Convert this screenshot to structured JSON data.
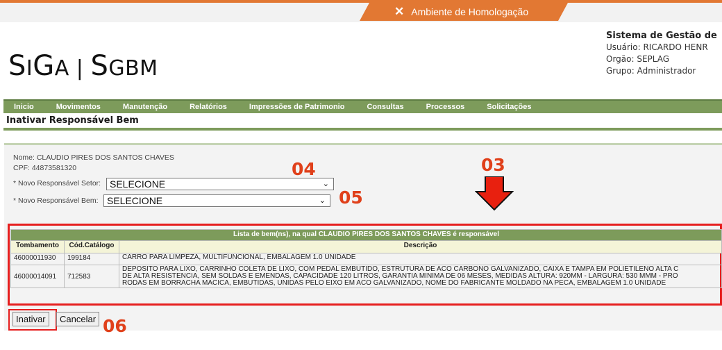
{
  "environment": {
    "label": "Ambiente de Homologação",
    "icon": "tools-icon",
    "color": "#e27833"
  },
  "logo": {
    "text_big_1": "S",
    "text_small_1": "I",
    "text_big_2": "G",
    "text_small_2": "A | ",
    "text_big_3": "S",
    "text_small_3": "GBM"
  },
  "system": {
    "title": "Sistema de Gestão de",
    "user": "Usuário: RICARDO HENR",
    "orgao": "Orgão: SEPLAG",
    "grupo": "Grupo: Administrador"
  },
  "menu": [
    "Inicio",
    "Movimentos",
    "Manutenção",
    "Relatórios",
    "Impressões de Patrimonio",
    "Consultas",
    "Processos",
    "Solicitações"
  ],
  "page_title": "Inativar Responsável Bem",
  "person": {
    "nome": "Nome: CLAUDIO PIRES DOS SANTOS CHAVES",
    "cpf": "CPF:  44873581320"
  },
  "fields": {
    "setor_label": "* Novo Responsável Setor:",
    "setor_value": "SELECIONE",
    "bem_label": "* Novo Responsável Bem:",
    "bem_value": "SELECIONE"
  },
  "annotations": {
    "a03": "03",
    "a04": "04",
    "a05": "05",
    "a06": "06"
  },
  "table": {
    "caption": "Lista de bem(ns), na qual CLAUDIO PIRES DOS SANTOS CHAVES é responsável",
    "headers": [
      "Tombamento",
      "Cód.Catálogo",
      "Descrição"
    ],
    "rows": [
      {
        "tombamento": "46000011930",
        "catalogo": "199184",
        "descricao": [
          "CARRO PARA LIMPEZA, MULTIFUNCIONAL, EMBALAGEM 1.0 UNIDADE"
        ]
      },
      {
        "tombamento": "46000014091",
        "catalogo": "712583",
        "descricao": [
          "DEPOSITO PARA LIXO, CARRINHO COLETA DE LIXO, COM PEDAL EMBUTIDO, ESTRUTURA DE ACO CARBONO GALVANIZADO, CAIXA E TAMPA EM POLIETILENO ALTA C",
          "DE ALTA RESISTENCIA, SEM SOLDAS E EMENDAS, CAPACIDADE 120 LITROS, GARANTIA MINIMA DE 06 MESES, MEDIDAS ALTURA: 920MM - LARGURA: 530 MMM - PRO",
          "RODAS EM BORRACHA MACICA, EMBUTIDAS, UNIDAS PELO EIXO EM ACO GALVANIZADO, NOME DO FABRICANTE MOLDADO NA PECA, EMBALAGEM 1.0 UNIDADE"
        ]
      }
    ]
  },
  "buttons": {
    "inativar": "Inativar",
    "cancelar": "Cancelar"
  },
  "colors": {
    "menu_green": "#7d9b5b",
    "annotation_red": "#e0401a",
    "highlight_red": "#e61e1e"
  }
}
